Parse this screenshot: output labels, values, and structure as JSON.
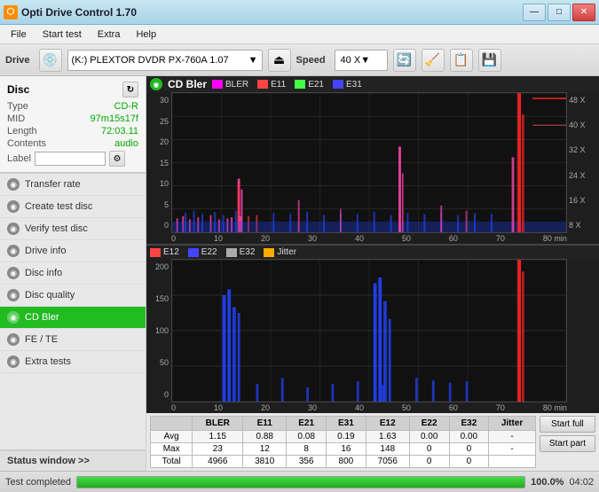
{
  "app": {
    "title": "Opti Drive Control 1.70",
    "icon": "⬡"
  },
  "title_buttons": {
    "minimize": "—",
    "maximize": "□",
    "close": "✕"
  },
  "menu": {
    "items": [
      "File",
      "Start test",
      "Extra",
      "Help"
    ]
  },
  "toolbar": {
    "drive_label": "Drive",
    "drive_icon": "💾",
    "drive_value": "(K:) PLEXTOR DVDR  PX-760A 1.07",
    "speed_label": "Speed",
    "speed_value": "40 X"
  },
  "disc": {
    "header": "Disc",
    "type_label": "Type",
    "type_value": "CD-R",
    "mid_label": "MID",
    "mid_value": "97m15s17f",
    "length_label": "Length",
    "length_value": "72:03.11",
    "contents_label": "Contents",
    "contents_value": "audio",
    "label_label": "Label",
    "label_value": ""
  },
  "nav": {
    "items": [
      {
        "id": "transfer-rate",
        "label": "Transfer rate",
        "active": false
      },
      {
        "id": "create-test-disc",
        "label": "Create test disc",
        "active": false
      },
      {
        "id": "verify-test-disc",
        "label": "Verify test disc",
        "active": false
      },
      {
        "id": "drive-info",
        "label": "Drive info",
        "active": false
      },
      {
        "id": "disc-info",
        "label": "Disc info",
        "active": false
      },
      {
        "id": "disc-quality",
        "label": "Disc quality",
        "active": false
      },
      {
        "id": "cd-bler",
        "label": "CD Bler",
        "active": true
      },
      {
        "id": "fe-te",
        "label": "FE / TE",
        "active": false
      },
      {
        "id": "extra-tests",
        "label": "Extra tests",
        "active": false
      }
    ],
    "status_window": "Status window >>"
  },
  "chart_top": {
    "title": "CD Bler",
    "legend": [
      {
        "label": "BLER",
        "color": "#ff00ff"
      },
      {
        "label": "E11",
        "color": "#ff4444"
      },
      {
        "label": "E21",
        "color": "#44ff44"
      },
      {
        "label": "E31",
        "color": "#4444ff"
      }
    ],
    "y_labels": [
      "30",
      "25",
      "20",
      "15",
      "10",
      "5",
      "0"
    ],
    "x_labels": [
      "0",
      "10",
      "20",
      "30",
      "40",
      "50",
      "60",
      "70"
    ],
    "x_unit": "80 min",
    "right_labels": [
      "48 X",
      "40 X",
      "32 X",
      "24 X",
      "16 X",
      "8 X"
    ]
  },
  "chart_bottom": {
    "legend": [
      {
        "label": "E12",
        "color": "#ff4444"
      },
      {
        "label": "E22",
        "color": "#4444ff"
      },
      {
        "label": "E32",
        "color": "#888888"
      },
      {
        "label": "Jitter",
        "color": "#ffaa00"
      }
    ],
    "y_labels": [
      "200",
      "150",
      "100",
      "50",
      "0"
    ],
    "x_labels": [
      "0",
      "10",
      "20",
      "30",
      "40",
      "50",
      "60",
      "70"
    ],
    "x_unit": "80 min",
    "right_labels": []
  },
  "stats": {
    "columns": [
      "",
      "BLER",
      "E11",
      "E21",
      "E31",
      "E12",
      "E22",
      "E32",
      "Jitter"
    ],
    "rows": [
      {
        "label": "Avg",
        "values": [
          "1.15",
          "0.88",
          "0.08",
          "0.19",
          "1.63",
          "0.00",
          "0.00",
          "-"
        ]
      },
      {
        "label": "Max",
        "values": [
          "23",
          "12",
          "8",
          "16",
          "148",
          "0",
          "0",
          "-"
        ]
      },
      {
        "label": "Total",
        "values": [
          "4966",
          "3810",
          "356",
          "800",
          "7056",
          "0",
          "0",
          ""
        ]
      }
    ],
    "buttons": [
      "Start full",
      "Start part"
    ]
  },
  "status_bar": {
    "text": "Test completed",
    "progress": 100,
    "progress_text": "100.0%",
    "time": "04:02"
  }
}
